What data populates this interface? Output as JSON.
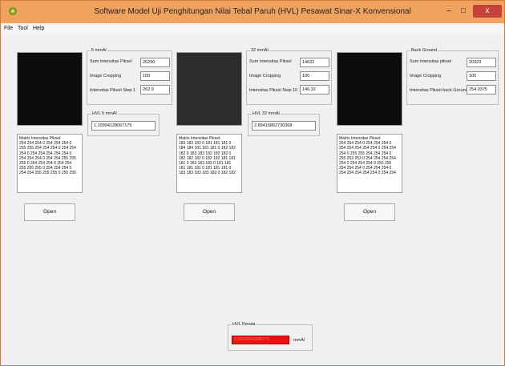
{
  "window": {
    "title": "Software Model Uji Penghitungan Nilai Tebal Paruh  (HVL) Pesawat Sinar-X  Konvensional",
    "controls": {
      "minimize": "–",
      "maximize": "□",
      "close": "x"
    }
  },
  "menu": [
    {
      "label": "File"
    },
    {
      "label": "Tool"
    },
    {
      "label": "Help"
    }
  ],
  "panels": [
    {
      "group_title": "5 mmAl",
      "sum_label": "Sum Intensitas Piksel",
      "sum_value": "26290",
      "crop_label": "Image Cropping",
      "crop_value": "100",
      "step_label": "Intensitas Piksel Step 1",
      "step_value": "262.9",
      "hvl_title": "HVL 5 mmAl",
      "hvl_value": "1.10994128067175",
      "matrix_title": "Matrix Intensitas Piksel:",
      "matrix_lines": [
        "254 254 254 0 254 254 254 0",
        "255 255 254 254 254 0 254 254",
        "254 0 254 254 254 254 254 0",
        "254 254 254 0 254 254 255 255",
        "255 0 254 254 254 0 254 254",
        "255 255 255 0 254 254 254 0",
        "254 254 255 255 255 0 255 255"
      ],
      "open_label": "Open"
    },
    {
      "group_title": "32 mmAl",
      "sum_label": "Sum Intensitas Piksel",
      "sum_value": "14632",
      "crop_label": "Image Cropping",
      "crop_value": "100",
      "step_label": "Intensitas Piksel Step 10",
      "step_value": "146.32",
      "hvl_title": "HVL 32 mmAl",
      "hvl_value": "2.89416862730368",
      "matrix_title": "Matrix Intensitas Piksel:",
      "matrix_lines": [
        "183 183 183 0 181 181 181 0",
        "184 184 181 181 181 0 182 182",
        "182 0 183 183 182 182 182 0",
        "182 182 182 0 182 182 181 181",
        "181 0 183 183 183 0 181 181",
        "181 181 181 0 181 181 181 0",
        "183 183 183 183 183 0 182 182"
      ],
      "open_label": "Open"
    },
    {
      "group_title": "Back Ground",
      "sum_label": "Sum Intensitas piksel",
      "sum_value": "20323",
      "crop_label": "Image Cropping",
      "crop_value": "100",
      "step_label": "Intensitas Piksel back Ground",
      "step_value": "254.0375",
      "matrix_title": "Matrix Intensitas Piksel:",
      "matrix_lines": [
        "254 254 254 0 254 254 254 0",
        "254 254 254 254 254 0 254 254",
        "254 0 255 255 254 254 254 0",
        "255 253 253 0 254 254 254 254",
        "254 0 254 254 254 0 255 255",
        "254 254 254 0 254 254 254 0",
        "254 254 254 254 254 0 254 254"
      ],
      "open_label": "Open"
    }
  ],
  "hvl_average": {
    "title": "HVL Rerata",
    "value": "2.0020549398771",
    "unit": "mmAl",
    "highlight_color": "#ee1111"
  }
}
